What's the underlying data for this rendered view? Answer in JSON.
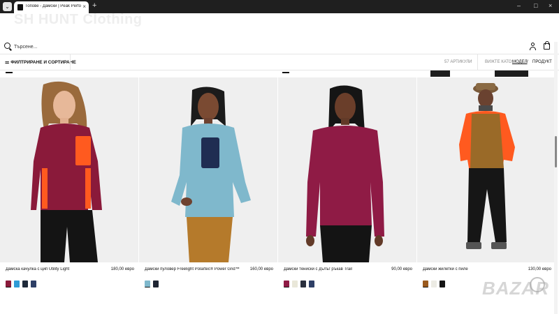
{
  "browser": {
    "tab_title": "Топове - Дамски | Peak Perfo",
    "tab_close": "×",
    "new_tab": "+",
    "minimize": "–",
    "maximize": "□",
    "close": "×"
  },
  "brand": {
    "name": "SH HUNT Clothing"
  },
  "search": {
    "placeholder": "Търсене..."
  },
  "toolbar": {
    "filter_label": "ФИЛТРИРАНЕ И СОРТИРАНЕ",
    "count": "57 АРТИКУЛИ",
    "view_label": "ВИЖТЕ КАТО:",
    "view_model": "МОДЕЛ",
    "view_slash": "/",
    "view_product": "ПРОДУКТ"
  },
  "products": [
    {
      "name": "Дамска качулка с цип Utility Light",
      "price": "180,00 евро",
      "swatches": [
        "#8a1a3a",
        "#2f9bd6",
        "#1f2a3a",
        "#2e3f66"
      ]
    },
    {
      "name": "Дамски пуловер Freelight Polartec® Power Grid™",
      "price": "160,00 евро",
      "swatches": [
        "#7fb8cc",
        "#1f2533"
      ]
    },
    {
      "name": "Дамски тениски с дълъг ръкав Trail",
      "price": "90,00 евро",
      "swatches": [
        "#8f1b45",
        "#e9e7d9",
        "#2a2f3d",
        "#2e3f66"
      ]
    },
    {
      "name": "Дамски жилетки с пиле",
      "price": "130,00 евро",
      "swatches": [
        "#9a5a1e",
        "#ecebe4",
        "#151515"
      ]
    }
  ],
  "watermark": "BAZAR",
  "colors": {
    "photo_bg": "#f0f0f0",
    "accent_red": "#8f1b45",
    "accent_blue": "#7fb8cc",
    "accent_orange": "#ff5a1f"
  }
}
